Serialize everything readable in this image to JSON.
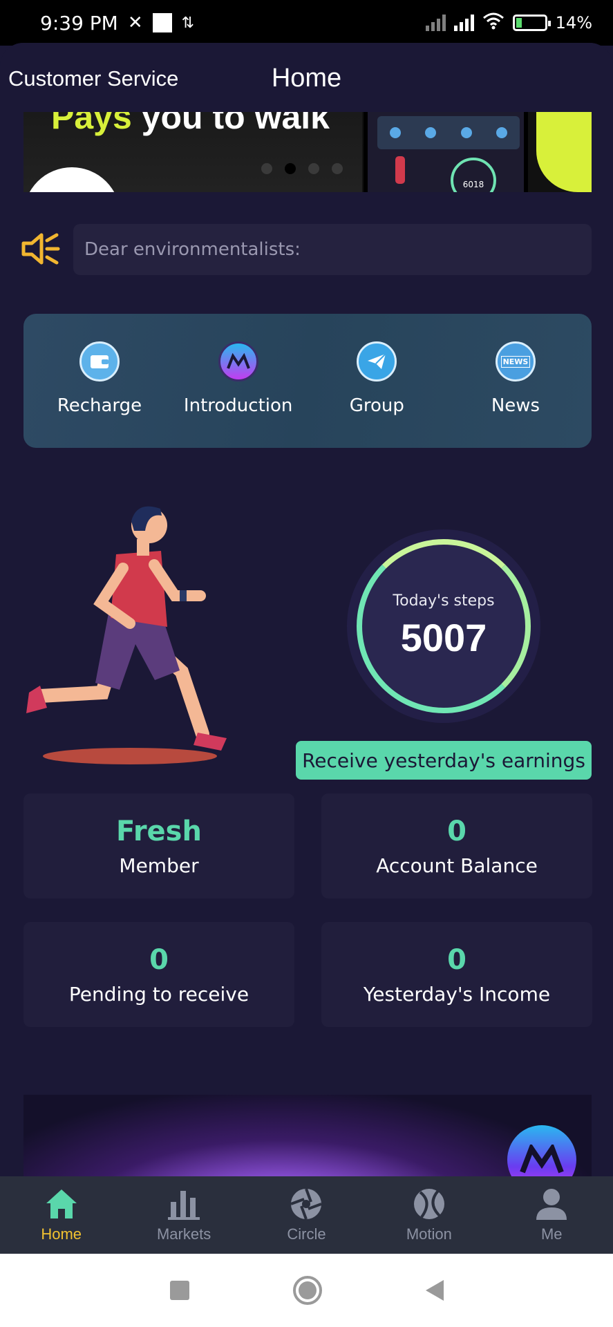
{
  "status_bar": {
    "time": "9:39 PM",
    "battery": "14%"
  },
  "header": {
    "customer_service": "Customer Service",
    "title": "Home"
  },
  "banner": {
    "headline_highlight": "Pays",
    "headline_rest": "you to walk",
    "phone_steps": "6018"
  },
  "notice": {
    "text": "Dear environmentalists:"
  },
  "menu": [
    {
      "label": "Recharge",
      "icon": "wallet-icon"
    },
    {
      "label": "Introduction",
      "icon": "ms-logo-icon"
    },
    {
      "label": "Group",
      "icon": "telegram-icon"
    },
    {
      "label": "News",
      "icon": "news-icon"
    }
  ],
  "steps": {
    "label": "Today's steps",
    "value": "5007"
  },
  "earnings_button": "Receive yesterday's earnings",
  "stats": [
    {
      "value": "Fresh",
      "label": "Member"
    },
    {
      "value": "0",
      "label": "Account Balance"
    },
    {
      "value": "0",
      "label": "Pending to receive"
    },
    {
      "value": "0",
      "label": "Yesterday's Income"
    }
  ],
  "tabs": [
    {
      "label": "Home",
      "icon": "home-icon",
      "active": true
    },
    {
      "label": "Markets",
      "icon": "bar-chart-icon",
      "active": false
    },
    {
      "label": "Circle",
      "icon": "aperture-icon",
      "active": false
    },
    {
      "label": "Motion",
      "icon": "ball-icon",
      "active": false
    },
    {
      "label": "Me",
      "icon": "user-icon",
      "active": false
    }
  ],
  "colors": {
    "accent": "#5ad7ab",
    "active_tab": "#f2c230",
    "background": "#1b1836"
  }
}
